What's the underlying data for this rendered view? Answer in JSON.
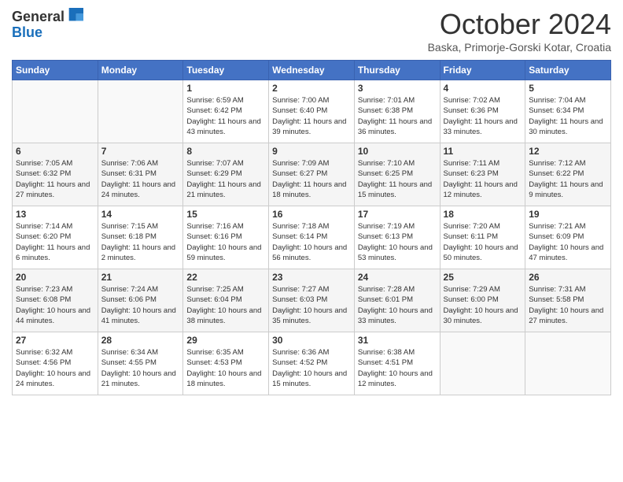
{
  "header": {
    "logo_general": "General",
    "logo_blue": "Blue",
    "month_year": "October 2024",
    "location": "Baska, Primorje-Gorski Kotar, Croatia"
  },
  "days_of_week": [
    "Sunday",
    "Monday",
    "Tuesday",
    "Wednesday",
    "Thursday",
    "Friday",
    "Saturday"
  ],
  "weeks": [
    [
      {
        "day": "",
        "info": ""
      },
      {
        "day": "",
        "info": ""
      },
      {
        "day": "1",
        "info": "Sunrise: 6:59 AM\nSunset: 6:42 PM\nDaylight: 11 hours and 43 minutes."
      },
      {
        "day": "2",
        "info": "Sunrise: 7:00 AM\nSunset: 6:40 PM\nDaylight: 11 hours and 39 minutes."
      },
      {
        "day": "3",
        "info": "Sunrise: 7:01 AM\nSunset: 6:38 PM\nDaylight: 11 hours and 36 minutes."
      },
      {
        "day": "4",
        "info": "Sunrise: 7:02 AM\nSunset: 6:36 PM\nDaylight: 11 hours and 33 minutes."
      },
      {
        "day": "5",
        "info": "Sunrise: 7:04 AM\nSunset: 6:34 PM\nDaylight: 11 hours and 30 minutes."
      }
    ],
    [
      {
        "day": "6",
        "info": "Sunrise: 7:05 AM\nSunset: 6:32 PM\nDaylight: 11 hours and 27 minutes."
      },
      {
        "day": "7",
        "info": "Sunrise: 7:06 AM\nSunset: 6:31 PM\nDaylight: 11 hours and 24 minutes."
      },
      {
        "day": "8",
        "info": "Sunrise: 7:07 AM\nSunset: 6:29 PM\nDaylight: 11 hours and 21 minutes."
      },
      {
        "day": "9",
        "info": "Sunrise: 7:09 AM\nSunset: 6:27 PM\nDaylight: 11 hours and 18 minutes."
      },
      {
        "day": "10",
        "info": "Sunrise: 7:10 AM\nSunset: 6:25 PM\nDaylight: 11 hours and 15 minutes."
      },
      {
        "day": "11",
        "info": "Sunrise: 7:11 AM\nSunset: 6:23 PM\nDaylight: 11 hours and 12 minutes."
      },
      {
        "day": "12",
        "info": "Sunrise: 7:12 AM\nSunset: 6:22 PM\nDaylight: 11 hours and 9 minutes."
      }
    ],
    [
      {
        "day": "13",
        "info": "Sunrise: 7:14 AM\nSunset: 6:20 PM\nDaylight: 11 hours and 6 minutes."
      },
      {
        "day": "14",
        "info": "Sunrise: 7:15 AM\nSunset: 6:18 PM\nDaylight: 11 hours and 2 minutes."
      },
      {
        "day": "15",
        "info": "Sunrise: 7:16 AM\nSunset: 6:16 PM\nDaylight: 10 hours and 59 minutes."
      },
      {
        "day": "16",
        "info": "Sunrise: 7:18 AM\nSunset: 6:14 PM\nDaylight: 10 hours and 56 minutes."
      },
      {
        "day": "17",
        "info": "Sunrise: 7:19 AM\nSunset: 6:13 PM\nDaylight: 10 hours and 53 minutes."
      },
      {
        "day": "18",
        "info": "Sunrise: 7:20 AM\nSunset: 6:11 PM\nDaylight: 10 hours and 50 minutes."
      },
      {
        "day": "19",
        "info": "Sunrise: 7:21 AM\nSunset: 6:09 PM\nDaylight: 10 hours and 47 minutes."
      }
    ],
    [
      {
        "day": "20",
        "info": "Sunrise: 7:23 AM\nSunset: 6:08 PM\nDaylight: 10 hours and 44 minutes."
      },
      {
        "day": "21",
        "info": "Sunrise: 7:24 AM\nSunset: 6:06 PM\nDaylight: 10 hours and 41 minutes."
      },
      {
        "day": "22",
        "info": "Sunrise: 7:25 AM\nSunset: 6:04 PM\nDaylight: 10 hours and 38 minutes."
      },
      {
        "day": "23",
        "info": "Sunrise: 7:27 AM\nSunset: 6:03 PM\nDaylight: 10 hours and 35 minutes."
      },
      {
        "day": "24",
        "info": "Sunrise: 7:28 AM\nSunset: 6:01 PM\nDaylight: 10 hours and 33 minutes."
      },
      {
        "day": "25",
        "info": "Sunrise: 7:29 AM\nSunset: 6:00 PM\nDaylight: 10 hours and 30 minutes."
      },
      {
        "day": "26",
        "info": "Sunrise: 7:31 AM\nSunset: 5:58 PM\nDaylight: 10 hours and 27 minutes."
      }
    ],
    [
      {
        "day": "27",
        "info": "Sunrise: 6:32 AM\nSunset: 4:56 PM\nDaylight: 10 hours and 24 minutes."
      },
      {
        "day": "28",
        "info": "Sunrise: 6:34 AM\nSunset: 4:55 PM\nDaylight: 10 hours and 21 minutes."
      },
      {
        "day": "29",
        "info": "Sunrise: 6:35 AM\nSunset: 4:53 PM\nDaylight: 10 hours and 18 minutes."
      },
      {
        "day": "30",
        "info": "Sunrise: 6:36 AM\nSunset: 4:52 PM\nDaylight: 10 hours and 15 minutes."
      },
      {
        "day": "31",
        "info": "Sunrise: 6:38 AM\nSunset: 4:51 PM\nDaylight: 10 hours and 12 minutes."
      },
      {
        "day": "",
        "info": ""
      },
      {
        "day": "",
        "info": ""
      }
    ]
  ]
}
